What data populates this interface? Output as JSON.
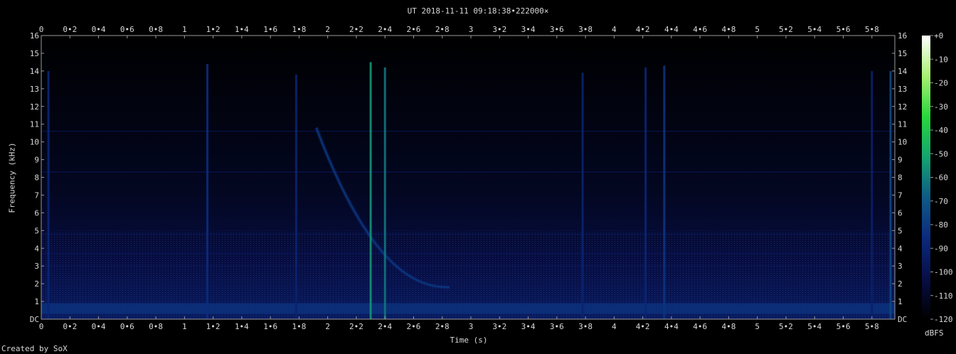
{
  "chart_data": {
    "type": "heatmap",
    "title": "UT 2018-11-11 09:18:38•222000×",
    "xlabel": "Time (s)",
    "ylabel": "Frequency (kHz)",
    "credit": "Created by SoX",
    "colorbar_label": "dBFS",
    "xlim": [
      0,
      5.96
    ],
    "ylim": [
      0,
      16
    ],
    "x_ticks": [
      "0",
      "0•2",
      "0•4",
      "0•6",
      "0•8",
      "1",
      "1•2",
      "1•4",
      "1•6",
      "1•8",
      "2",
      "2•2",
      "2•4",
      "2•6",
      "2•8",
      "3",
      "3•2",
      "3•4",
      "3•6",
      "3•8",
      "4",
      "4•2",
      "4•4",
      "4•6",
      "4•8",
      "5",
      "5•2",
      "5•4",
      "5•6",
      "5•8"
    ],
    "y_ticks": [
      "DC",
      "1",
      "2",
      "3",
      "4",
      "5",
      "6",
      "7",
      "8",
      "9",
      "10",
      "11",
      "12",
      "13",
      "14",
      "15",
      "16"
    ],
    "colorbar_ticks": [
      "+0",
      "-10",
      "-20",
      "-30",
      "-40",
      "-50",
      "-60",
      "-70",
      "-80",
      "-90",
      "-100",
      "-110",
      "-120"
    ],
    "colorbar_range_dbfs": [
      -120,
      0
    ],
    "background_level_dbfs": -108,
    "low_freq_band": {
      "f_khz": [
        0.3,
        0.9
      ],
      "level_dbfs": -82
    },
    "hum_lines_khz": [
      3.0,
      3.7,
      4.8,
      8.3,
      10.6
    ],
    "sferics": [
      {
        "t": 0.05,
        "f_top": 14.0,
        "level_dbfs": -88
      },
      {
        "t": 1.16,
        "f_top": 14.4,
        "level_dbfs": -85
      },
      {
        "t": 1.78,
        "f_top": 13.8,
        "level_dbfs": -90
      },
      {
        "t": 2.3,
        "f_top": 14.5,
        "level_dbfs": -55
      },
      {
        "t": 2.4,
        "f_top": 14.2,
        "level_dbfs": -62
      },
      {
        "t": 3.78,
        "f_top": 13.9,
        "level_dbfs": -90
      },
      {
        "t": 4.22,
        "f_top": 14.2,
        "level_dbfs": -88
      },
      {
        "t": 4.35,
        "f_top": 14.3,
        "level_dbfs": -82
      },
      {
        "t": 5.8,
        "f_top": 14.0,
        "level_dbfs": -92
      },
      {
        "t": 5.93,
        "f_top": 14.0,
        "level_dbfs": -75
      }
    ],
    "whistler": {
      "t_start": 1.92,
      "f_start_khz": 10.8,
      "t_end": 2.85,
      "f_end_khz": 1.8,
      "level_dbfs": -85
    },
    "colormap": [
      "#000000",
      "#070e46",
      "#0b2a7e",
      "#0f5a86",
      "#14a470",
      "#28d63c",
      "#a8f070",
      "#ffffff"
    ]
  }
}
